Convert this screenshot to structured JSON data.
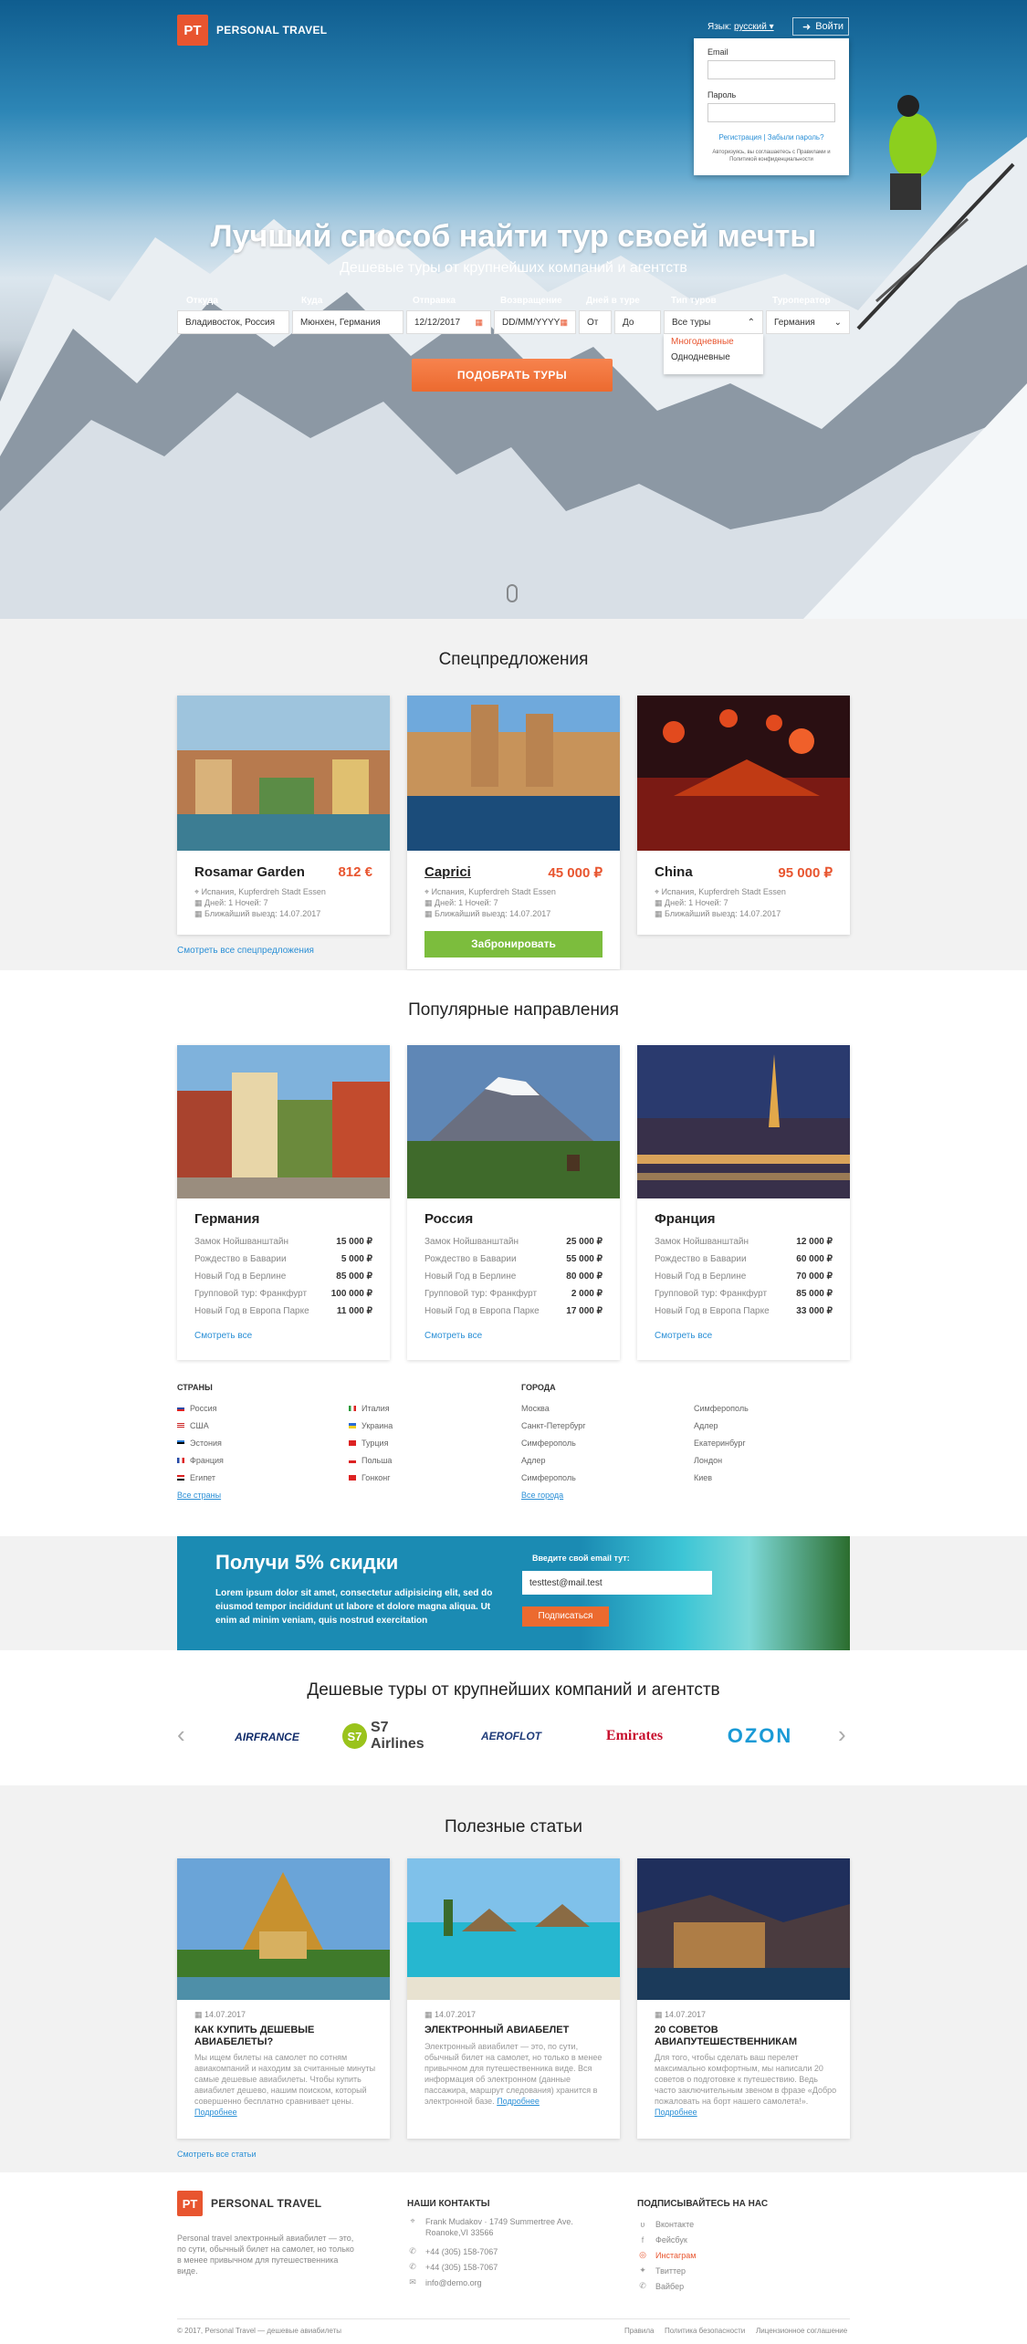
{
  "header": {
    "logo_mark": "PT",
    "logo_text": "PERSONAL TRAVEL",
    "lang_label": "Язык:",
    "lang_value": "русский ▾",
    "login_label": "Войти"
  },
  "login": {
    "email_label": "Email",
    "password_label": "Пароль",
    "links": "Регистрация | Забыли пароль?",
    "agree": "Авторизуясь, вы соглашаетесь с Правилами и Политикой конфиденциальности"
  },
  "hero": {
    "title": "Лучший способ найти тур своей мечты",
    "subtitle": "Дешевые туры от крупнейших компаний и агентств"
  },
  "search": {
    "from_label": "Откуда",
    "from_value": "Владивосток, Россия",
    "to_label": "Куда",
    "to_value": "Мюнхен, Германия",
    "depart_label": "Отправка",
    "depart_value": "12/12/2017",
    "return_label": "Возвращение",
    "return_value": "DD/MM/YYYY",
    "days_label": "Дней в туре",
    "days_from": "От",
    "days_to": "До",
    "type_label": "Тип туров",
    "type_value": "Все туры",
    "type_options": [
      "Многодневные",
      "Однодневные"
    ],
    "operator_label": "Туроператор",
    "operator_value": "Германия",
    "button": "ПОДОБРАТЬ ТУРЫ"
  },
  "specials": {
    "title": "Спецпредложения",
    "all_link": "Смотреть все спецпредложения",
    "book_button": "Забронировать",
    "items": [
      {
        "name": "Rosamar Garden",
        "price": "812 €",
        "location": "Испания, Kupferdreh Stadt Essen",
        "days": "Дней: 1   Ночей: 7",
        "nearest": "Ближайший выезд: 14.07.2017"
      },
      {
        "name": "Caprici",
        "price": "45 000 ₽",
        "location": "Испания, Kupferdreh Stadt Essen",
        "days": "Дней: 1   Ночей: 7",
        "nearest": "Ближайший выезд: 14.07.2017"
      },
      {
        "name": "China",
        "price": "95 000 ₽",
        "location": "Испания, Kupferdreh Stadt Essen",
        "days": "Дней: 1   Ночей: 7",
        "nearest": "Ближайший выезд: 14.07.2017"
      }
    ]
  },
  "destinations": {
    "title": "Популярные направления",
    "see_all": "Смотреть все",
    "items": [
      {
        "name": "Германия",
        "rows": [
          [
            "Замок Нойшванштайн",
            "15 000 ₽"
          ],
          [
            "Рождество в Баварии",
            "5 000 ₽"
          ],
          [
            "Новый Год в Берлине",
            "85 000 ₽"
          ],
          [
            "Групповой тур: Франкфурт",
            "100 000 ₽"
          ],
          [
            "Новый Год в Европа Парке",
            "11 000 ₽"
          ]
        ]
      },
      {
        "name": "Россия",
        "rows": [
          [
            "Замок Нойшванштайн",
            "25 000 ₽"
          ],
          [
            "Рождество в Баварии",
            "55 000 ₽"
          ],
          [
            "Новый Год в Берлине",
            "80 000 ₽"
          ],
          [
            "Групповой тур: Франкфурт",
            "2 000 ₽"
          ],
          [
            "Новый Год в Европа Парке",
            "17 000 ₽"
          ]
        ]
      },
      {
        "name": "Франция",
        "rows": [
          [
            "Замок Нойшванштайн",
            "12 000 ₽"
          ],
          [
            "Рождество в Баварии",
            "60 000 ₽"
          ],
          [
            "Новый Год в Берлине",
            "70 000 ₽"
          ],
          [
            "Групповой тур: Франкфурт",
            "85 000 ₽"
          ],
          [
            "Новый Год в Европа Парке",
            "33 000 ₽"
          ]
        ]
      }
    ]
  },
  "lists": {
    "countries_head": "СТРАНЫ",
    "cities_head": "ГОРОДА",
    "countries_a": [
      "Россия",
      "США",
      "Эстония",
      "Франция",
      "Египет"
    ],
    "countries_b": [
      "Италия",
      "Украина",
      "Турция",
      "Польша",
      "Гонконг"
    ],
    "cities_a": [
      "Москва",
      "Санкт-Петербург",
      "Симферополь",
      "Адлер",
      "Симферополь"
    ],
    "cities_b": [
      "Симферополь",
      "Адлер",
      "Екатеринбург",
      "Лондон",
      "Киев"
    ],
    "all_countries": "Все страны",
    "all_cities": "Все города"
  },
  "promo": {
    "title": "Получи 5% скидки",
    "text": "Lorem ipsum dolor sit amet, consectetur adipisicing elit, sed do eiusmod tempor incididunt ut labore et dolore magna aliqua. Ut enim ad minim veniam, quis nostrud exercitation",
    "email_label": "Введите свой email тут:",
    "email_value": "testtest@mail.test",
    "button": "Подписаться"
  },
  "partners": {
    "title": "Дешевые туры от крупнейших компаний и агентств",
    "items": [
      "AIRFRANCE",
      "S7 Airlines",
      "AEROFLOT",
      "Emirates",
      "OZON"
    ]
  },
  "articles": {
    "title": "Полезные статьи",
    "all_link": "Смотреть все статьи",
    "items": [
      {
        "date": "14.07.2017",
        "title": "КАК КУПИТЬ ДЕШЕВЫЕ АВИАБЕЛЕТЫ?",
        "text": "Мы ищем билеты на самолет по сотням авиакомпаний и находим за считанные минуты самые дешевые авиабилеты. Чтобы купить авиабилет дешево, нашим поиском, который совершенно бесплатно сравнивает цены.",
        "more": "Подробнее"
      },
      {
        "date": "14.07.2017",
        "title": "ЭЛЕКТРОННЫЙ АВИАБЕЛЕТ",
        "text": "Электронный авиабилет — это, по сути, обычный билет на самолет, но только в менее привычном для путешественника виде. Вся информация об электронном (данные пассажира, маршрут следования) хранится в электронной базе.",
        "more": "Подробнее"
      },
      {
        "date": "14.07.2017",
        "title": "20 СОВЕТОВ АВИАПУТЕШЕСТВЕННИКАМ",
        "text": "Для того, чтобы сделать ваш перелет максимально комфортным, мы написали 20 советов о подготовке к путешествию. Ведь часто заключительным звеном в фразе «Добро пожаловать на борт нашего самолета!».",
        "more": "Подробнее"
      }
    ]
  },
  "footer": {
    "about": "Personal travel электронный авиабилет — это, по сути, обычный билет на самолет, но только в менее привычном для путешественника виде.",
    "contacts_head": "НАШИ КОНТАКТЫ",
    "address": "Frank Mudakov · 1749 Summertree Ave. Roanoke,VI 33566",
    "phone1": "+44 (305) 158-7067",
    "phone2": "+44 (305) 158-7067",
    "email": "info@demo.org",
    "social_head": "ПОДПИСЫВАЙТЕСЬ НА НАС",
    "social": [
      "Вконтакте",
      "Фейсбук",
      "Инстаграм",
      "Твиттер",
      "Вайбер"
    ],
    "copyright": "© 2017, Personal Travel — дешевые авиабилеты",
    "bottom_links": [
      "Правила",
      "Политика безопасности",
      "Лицензионное соглашение"
    ]
  }
}
